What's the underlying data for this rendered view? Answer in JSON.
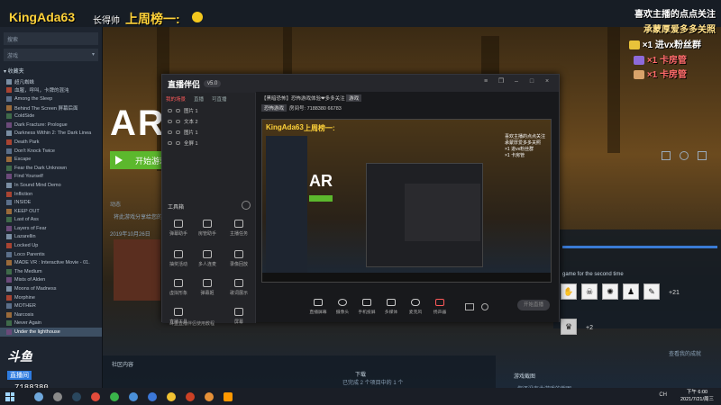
{
  "overlay": {
    "streamer_name": "KingAda63",
    "streamer_tag": "长得帅",
    "rank_text": "上周榜一:",
    "right_lines": [
      {
        "text": "喜欢主播的点点关注",
        "style": "normal"
      },
      {
        "text": "承蒙厚爱多多关照",
        "style": "gold"
      },
      {
        "text": "×1  进vx粉丝群",
        "style": "normal"
      },
      {
        "text": "×1  卡房管",
        "style": "red"
      },
      {
        "text": "×1  卡房管",
        "style": "red"
      }
    ],
    "platform_logo": "斗鱼",
    "platform_sub": "直播间",
    "room_number": "7188380"
  },
  "steam": {
    "search_placeholder": "搜索",
    "filter_label": "游戏",
    "collection_header": "▾ 收藏夹",
    "games": [
      "超凡蜘蛛",
      "血腥，呼叫，卡牌的混沌",
      "Among the Sleep",
      "Behind The Screen 屏幕后面",
      "ColdSide",
      "Dark Fracture: Prologue",
      "Darkness Within 2: The Dark Linea",
      "Death Park",
      "Don't Knock Twice",
      "Escape",
      "Fear the Dark Unknown",
      "Find Yourself",
      "In Sound Mind Demo",
      "Infliction",
      "INSIDE",
      "KEEP OUT",
      "Last of Ass",
      "Layers of Fear",
      "Lazarellin",
      "Locked Up",
      "Loco Parentis",
      "MADE VR : Interactive Movie - 01.",
      "The Medium",
      "Mists of Alden",
      "Moons of Madness",
      "Morphine",
      "MOTHER",
      "Narcosis",
      "Never Again",
      "Under the lighthouse"
    ],
    "active_game_index": 29,
    "hero_title": "AR",
    "play_button": "开始游戏",
    "section_news": "动态",
    "news_text": "将此游戏分享给您的好友",
    "date_label": "2019年10月26日",
    "section_community": "社区内容",
    "side_text_1": "game for the second time",
    "achievement_more": "+21",
    "achievement_more_2": "+2",
    "achievement_link": "查看我的成就",
    "notes_title": "游戏截图",
    "notes_text": "您还没有此游戏的截图",
    "downloads_label": "下载",
    "downloads_sub": "已完成 2 个项目中的 1 个"
  },
  "companion": {
    "app_name": "直播伴侣",
    "version": "v5.0",
    "tabs": [
      "我的场景",
      "直播",
      "可直播"
    ],
    "active_tab": 0,
    "sources": [
      "图片 1",
      "文本 2",
      "图片 1",
      "全屏 1"
    ],
    "tools_title": "工具箱",
    "tools": [
      "弹幕助手",
      "房管助手",
      "主播任务",
      "抽奖活动",
      "多人连麦",
      "录像回放",
      "虚拟形象",
      "弹幕姬",
      "歌词展示",
      "直播工具",
      "",
      "屏幕"
    ],
    "stream_title": "【黑暗恐怖】恐怖游戏体验❤多多关注",
    "stream_tag": "游戏",
    "stream_category": "恐怖游戏",
    "room_id_label": "房间号: 7188380",
    "online_count": "66783",
    "controls": [
      "直播屏幕",
      "摄像头",
      "手机投屏",
      "多媒体",
      "麦克风",
      "扬声器"
    ],
    "start_button": "开始直播",
    "bottom_note": "斗鱼直播伴侣使用教程"
  },
  "taskbar": {
    "tray_text": "CH",
    "time": "下午 6:00",
    "date": "2021/7/21/周三"
  }
}
